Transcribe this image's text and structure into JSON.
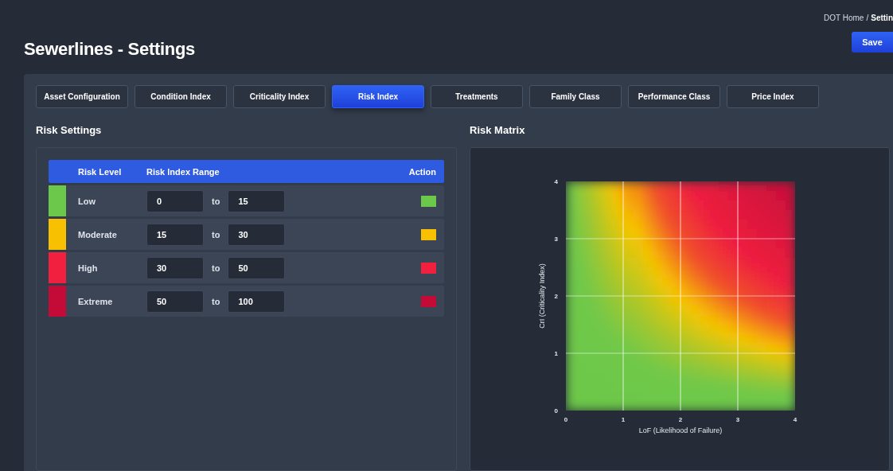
{
  "breadcrumb": {
    "parent": "DOT Home",
    "separator": "/",
    "current": "Settin"
  },
  "title": "Sewerlines - Settings",
  "save_button": "Save",
  "tabs": [
    {
      "label": "Asset Configuration",
      "selected": false
    },
    {
      "label": "Condition Index",
      "selected": false
    },
    {
      "label": "Criticality Index",
      "selected": false
    },
    {
      "label": "Risk Index",
      "selected": true
    },
    {
      "label": "Treatments",
      "selected": false
    },
    {
      "label": "Family Class",
      "selected": false
    },
    {
      "label": "Performance Class",
      "selected": false
    },
    {
      "label": "Price Index",
      "selected": false
    }
  ],
  "risk_settings": {
    "title": "Risk Settings",
    "columns": [
      "Risk Level",
      "Risk Index Range",
      "Action"
    ],
    "rows": [
      {
        "level": "Low",
        "from": "0",
        "joiner": "to",
        "to": "15",
        "color": "#6cc84a"
      },
      {
        "level": "Moderate",
        "from": "15",
        "joiner": "to",
        "to": "30",
        "color": "#f7c000"
      },
      {
        "level": "High",
        "from": "30",
        "joiner": "to",
        "to": "50",
        "color": "#f0203e"
      },
      {
        "level": "Extreme",
        "from": "50",
        "joiner": "to",
        "to": "100",
        "color": "#c40a36"
      }
    ]
  },
  "risk_matrix": {
    "title": "Risk Matrix",
    "xlabel": "LoF (Likelihood of Failure)",
    "ylabel": "CrI (Criticality Index)",
    "xticks": [
      "0",
      "1",
      "2",
      "3",
      "4"
    ],
    "yticks": [
      "4",
      "3",
      "2",
      "1",
      "0"
    ]
  }
}
